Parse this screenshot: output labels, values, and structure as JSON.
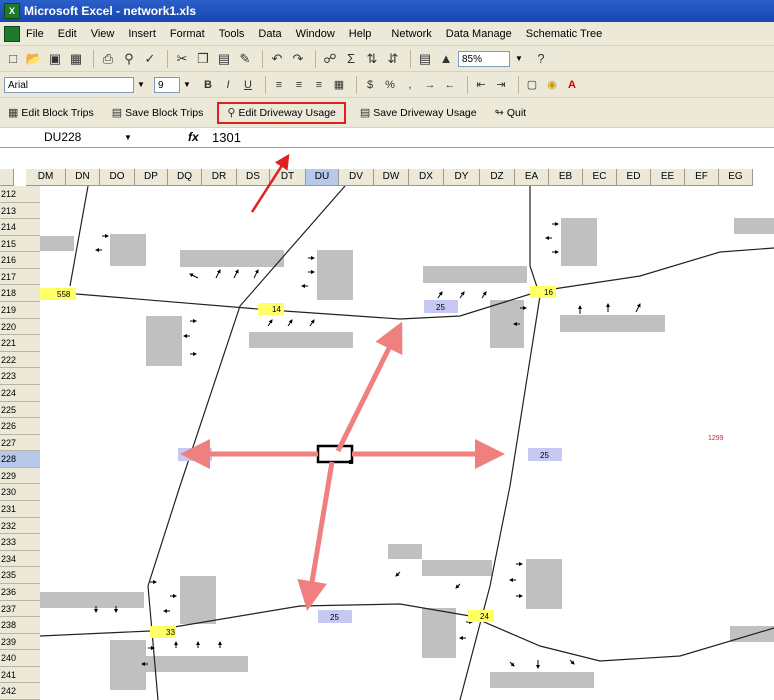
{
  "window": {
    "title": "Microsoft Excel - network1.xls"
  },
  "menu": {
    "items": [
      "File",
      "Edit",
      "View",
      "Insert",
      "Format",
      "Tools",
      "Data",
      "Window",
      "Help",
      "Network",
      "Data Manage",
      "Schematic Tree"
    ]
  },
  "toolbar": {
    "zoom": "85%",
    "font_name": "Arial",
    "font_size": "9"
  },
  "custom_toolbar": {
    "edit_block_trips": "Edit Block Trips",
    "save_block_trips": "Save Block Trips",
    "edit_driveway_usage": "Edit Driveway Usage",
    "save_driveway_usage": "Save Driveway Usage",
    "quit": "Quit"
  },
  "formula_bar": {
    "cell_ref": "DU228",
    "fx": "fx",
    "value": "1301"
  },
  "sheet": {
    "columns": [
      "DM",
      "DN",
      "DO",
      "DP",
      "DQ",
      "DR",
      "DS",
      "DT",
      "DU",
      "DV",
      "DW",
      "DX",
      "DY",
      "DZ",
      "EA",
      "EB",
      "EC",
      "ED",
      "EE",
      "EF",
      "EG"
    ],
    "active_column": "DU",
    "active_row": "228",
    "row_start": 212,
    "row_end": 242
  },
  "map": {
    "yellow_labels": [
      "558",
      "14",
      "16",
      "33",
      "24"
    ],
    "blue_labels": [
      "25",
      "25",
      "25",
      "25"
    ],
    "red_label": "1299"
  },
  "colors": {
    "accent_red": "#e02020",
    "arrow_pink": "#f08080",
    "node_yellow": "#ffff66",
    "node_blue": "#c8c8f4",
    "block_gray": "#c0c0c0"
  }
}
